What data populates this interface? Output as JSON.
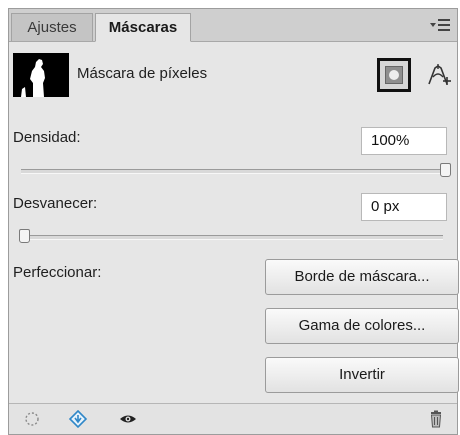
{
  "tabs": [
    {
      "label": "Ajustes",
      "active": false
    },
    {
      "label": "Máscaras",
      "active": true
    }
  ],
  "mask": {
    "label": "Máscara de píxeles"
  },
  "density": {
    "label": "Densidad:",
    "value": "100%",
    "slider_fraction": 1.0
  },
  "feather": {
    "label": "Desvanecer:",
    "value": "0 px",
    "slider_fraction": 0.0
  },
  "refine": {
    "label": "Perfeccionar:",
    "buttons": {
      "mask_edge": "Borde de máscara...",
      "color_range": "Gama de colores...",
      "invert": "Invertir"
    }
  },
  "footer_icons": [
    "load-selection-icon",
    "apply-mask-icon",
    "visibility-eye-icon",
    "trash-icon"
  ],
  "colors": {
    "panel_bg": "#e6e6e6",
    "tab_bar_bg": "#cfcfcf",
    "field_bg": "#ffffff",
    "accent_icon": "#2f87c8"
  }
}
